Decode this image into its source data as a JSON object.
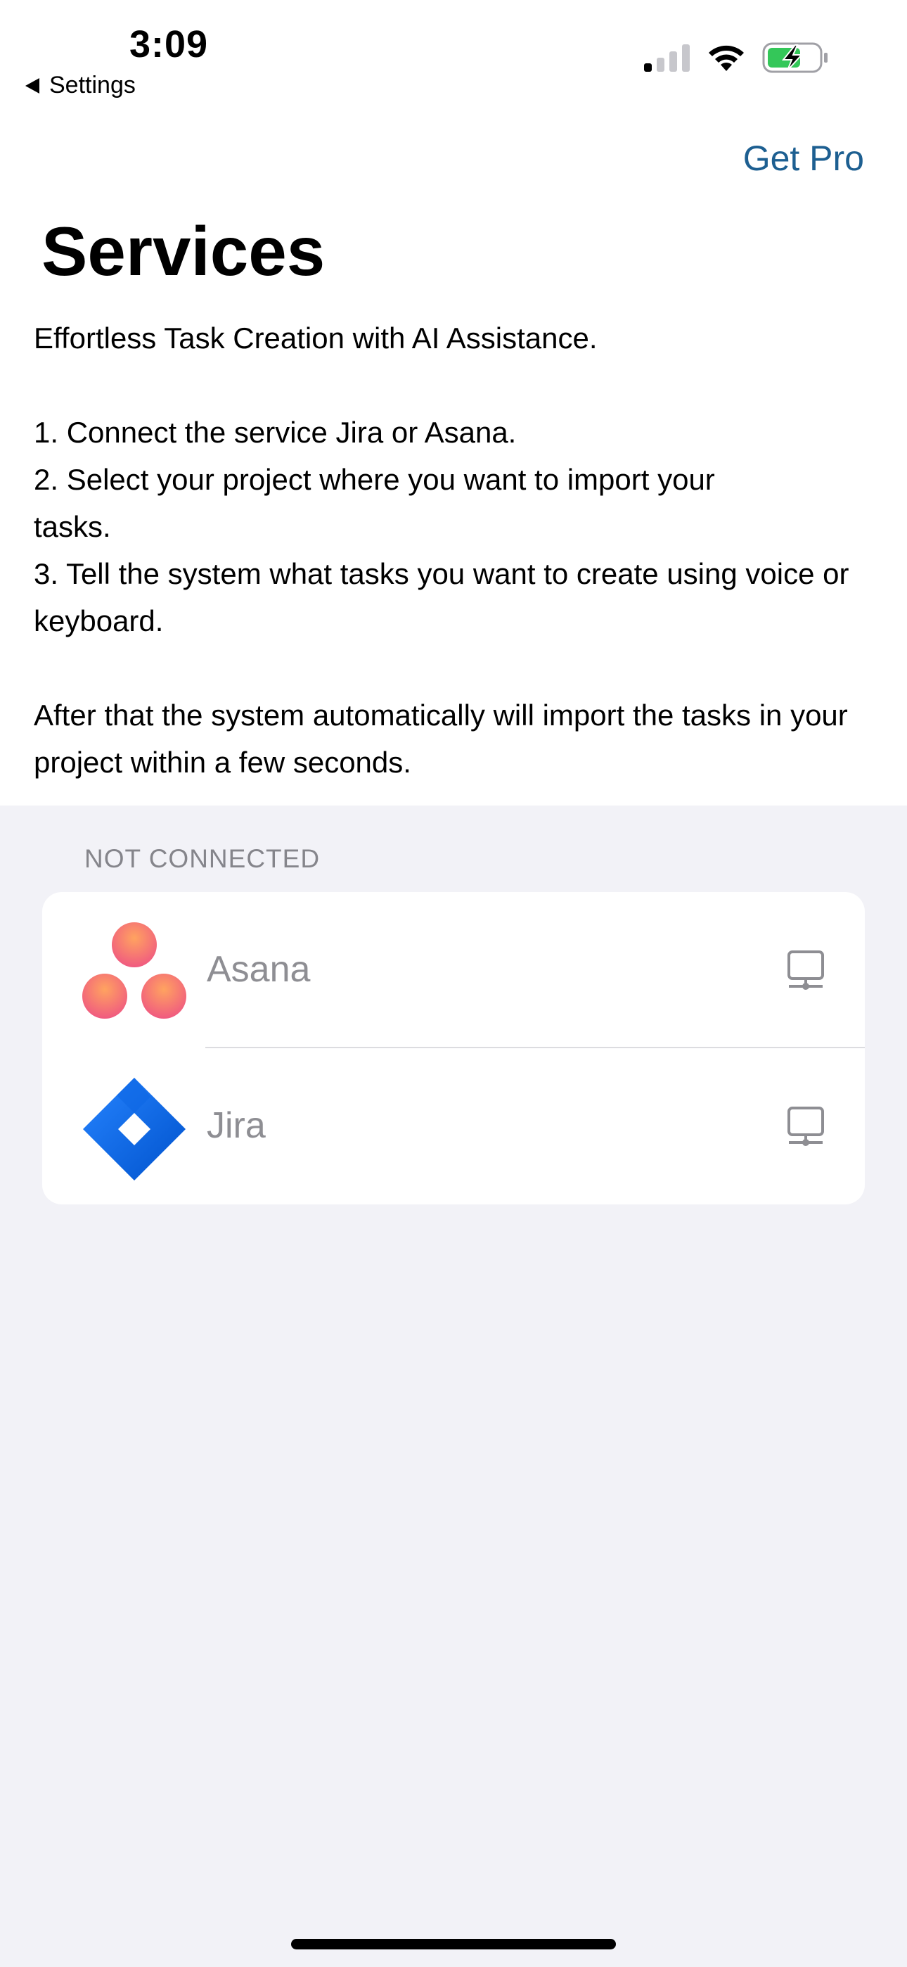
{
  "status_bar": {
    "time": "3:09",
    "back_label": "Settings",
    "icons": [
      "cellular-signal-icon",
      "wifi-icon",
      "battery-charging-icon"
    ],
    "battery_color": "#34c759"
  },
  "header": {
    "get_pro_label": "Get Pro",
    "title": "Services"
  },
  "description": {
    "intro": "Effortless Task Creation with AI Assistance.",
    "steps": [
      "1. Connect the service Jira or Asana.",
      "2. Select your project where you want to import your tasks.",
      "3. Tell the system what tasks you want to create using voice or keyboard."
    ],
    "outro": "After that the system automatically will import the tasks in your project within a few seconds."
  },
  "services_section": {
    "header": "NOT CONNECTED",
    "items": [
      {
        "label": "Asana",
        "logo": "asana-logo",
        "action_icon": "connect-desktop-icon"
      },
      {
        "label": "Jira",
        "logo": "jira-logo",
        "action_icon": "connect-desktop-icon"
      }
    ]
  },
  "colors": {
    "accent": "#1d5f91",
    "background": "#f2f2f7",
    "asana_pink": "#f06a7a",
    "jira_blue": "#2684ff"
  }
}
